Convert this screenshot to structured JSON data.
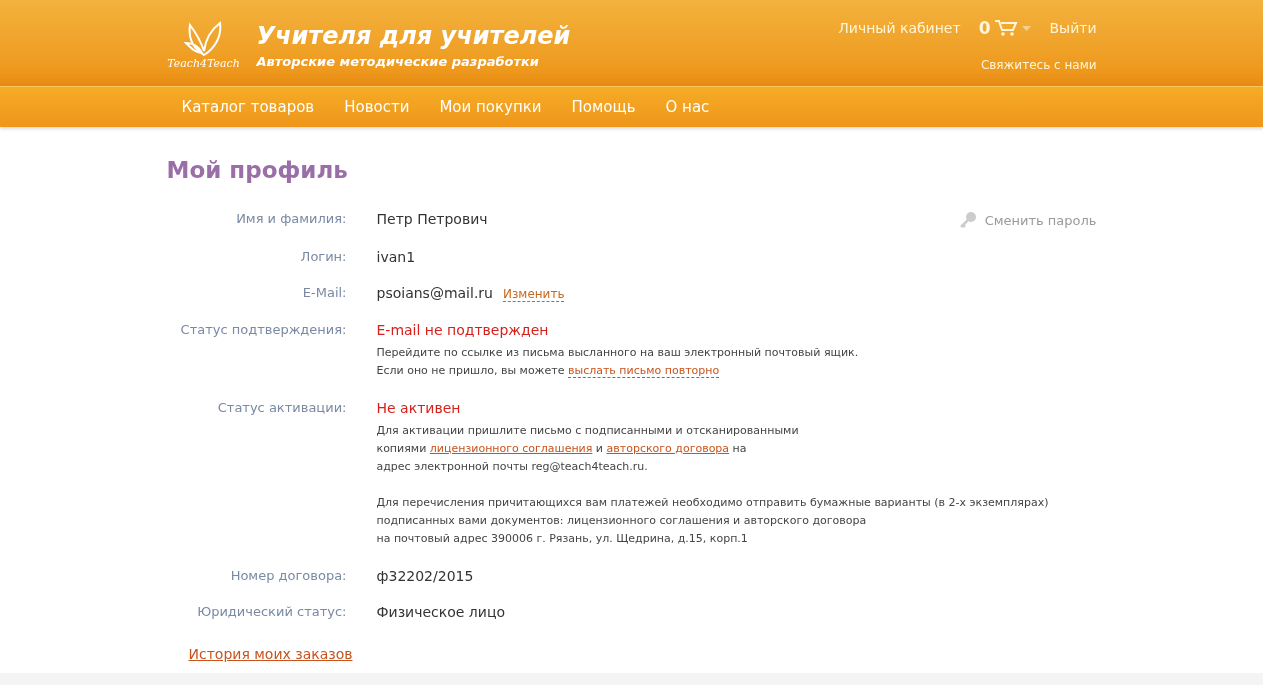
{
  "header": {
    "logo_text": "Teach4Teach",
    "title": "Учителя для учителей",
    "subtitle": "Авторские методические разработки",
    "account_link": "Личный кабинет",
    "cart_count": "0",
    "logout_link": "Выйти",
    "contact_link": "Свяжитесь с нами"
  },
  "nav": [
    "Каталог товаров",
    "Новости",
    "Мои покупки",
    "Помощь",
    "О нас"
  ],
  "page_title": "Мой профиль",
  "change_password": "Сменить пароль",
  "rows": [
    {
      "label": "Имя и фамилия:",
      "value": "Петр Петрович",
      "kind": "text"
    },
    {
      "label": "Логин:",
      "value": "ivan1",
      "kind": "text"
    },
    {
      "label": "E-Mail:",
      "value": "psoians@mail.ru",
      "kind": "text",
      "action": "Изменить"
    },
    {
      "label": "Статус подтверждения:",
      "value": "E-mail не подтвержден",
      "kind": "status",
      "notes": [
        [
          [
            {
              "text": "Перейдите по ссылке из письма высланного на ваш электронный почтовый ящик."
            }
          ],
          [
            {
              "text": "Если оно не пришло, вы можете "
            },
            {
              "link": "выслать письмо повторно",
              "kind": "action"
            }
          ]
        ]
      ]
    },
    {
      "label": "Статус активации:",
      "value": "Не активен",
      "kind": "status",
      "notes": [
        [
          [
            {
              "text": "Для активации пришлите письмо с подписанными и отсканированными"
            }
          ],
          [
            {
              "text": "копиями "
            },
            {
              "link": "лицензионного соглашения",
              "kind": "document"
            },
            {
              "text": " и "
            },
            {
              "link": "авторского договора",
              "kind": "document"
            },
            {
              "text": " на"
            }
          ],
          [
            {
              "text": "адрес электронной почты reg@teach4teach.ru."
            }
          ]
        ],
        [
          [
            {
              "text": "Для перечисления причитающихся вам платежей необходимо отправить бумажные варианты (в 2-х экземплярах)"
            }
          ],
          [
            {
              "text": "подписанных вами документов: лицензионного соглашения и авторского договора"
            }
          ],
          [
            {
              "text": "на почтовый адрес 390006 г. Рязань, ул. Щедрина, д.15, корп.1"
            }
          ]
        ]
      ]
    },
    {
      "label": "Номер договора:",
      "value": "ф32202/2015",
      "kind": "text"
    },
    {
      "label": "Юридический статус:",
      "value": "Физическое лицо",
      "kind": "text"
    }
  ],
  "orders_link": "История моих заказов"
}
